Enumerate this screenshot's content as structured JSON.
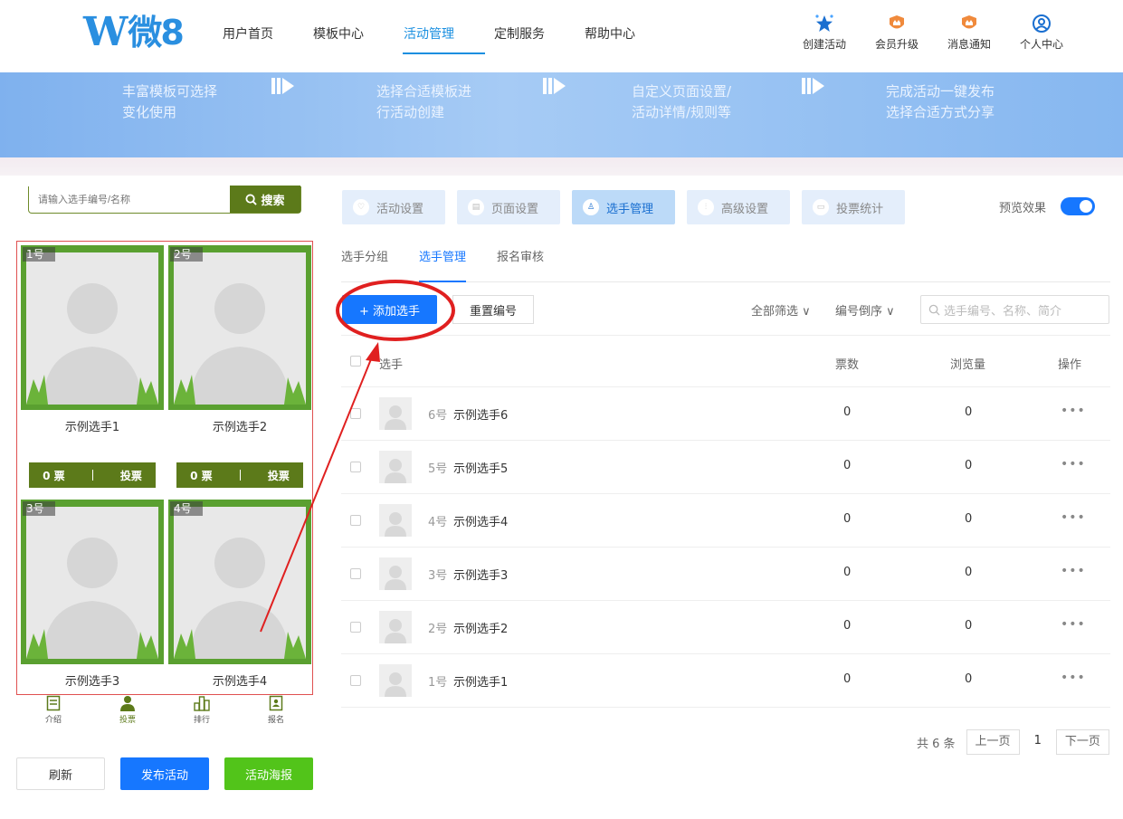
{
  "header": {
    "logo_text": "微8",
    "nav": [
      "用户首页",
      "模板中心",
      "活动管理",
      "定制服务",
      "帮助中心"
    ],
    "nav_active": "活动管理",
    "actions": [
      {
        "label": "创建活动",
        "icon": "star-icon"
      },
      {
        "label": "会员升级",
        "icon": "crown-badge-icon"
      },
      {
        "label": "消息通知",
        "icon": "crown-badge-icon"
      },
      {
        "label": "个人中心",
        "icon": "user-circle-icon"
      }
    ]
  },
  "banner": {
    "steps": [
      {
        "line1": "丰富模板可选择",
        "line2": "变化使用"
      },
      {
        "line1": "选择合适模板进",
        "line2": "行活动创建"
      },
      {
        "line1": "自定义页面设置/",
        "line2": "活动详情/规则等"
      },
      {
        "line1": "完成活动一键发布",
        "line2": "选择合适方式分享"
      }
    ]
  },
  "preview": {
    "search_placeholder": "请输入选手编号/名称",
    "search_button": "搜索",
    "cards": [
      {
        "badge": "1号",
        "name": "示例选手1",
        "votes": "0 票",
        "vote_button": "投票"
      },
      {
        "badge": "2号",
        "name": "示例选手2",
        "votes": "0 票",
        "vote_button": "投票"
      },
      {
        "badge": "3号",
        "name": "示例选手3"
      },
      {
        "badge": "4号",
        "name": "示例选手4"
      }
    ],
    "tabbar": [
      {
        "label": "介绍",
        "icon": "doc-icon"
      },
      {
        "label": "投票",
        "icon": "person-icon"
      },
      {
        "label": "排行",
        "icon": "rank-icon"
      },
      {
        "label": "报名",
        "icon": "signup-icon"
      }
    ],
    "buttons": {
      "refresh": "刷新",
      "publish": "发布活动",
      "poster": "活动海报"
    }
  },
  "settings_tabs": [
    "活动设置",
    "页面设置",
    "选手管理",
    "高级设置",
    "投票统计"
  ],
  "settings_tab_active": "选手管理",
  "preview_toggle": {
    "label": "预览效果",
    "on": true
  },
  "sub_tabs": [
    "选手分组",
    "选手管理",
    "报名审核"
  ],
  "sub_tab_active": "选手管理",
  "toolbar": {
    "add_button": "+ 添加选手",
    "reset_button": "重置编号",
    "filter_all": "全部筛选 ∨",
    "sort": "编号倒序 ∨",
    "search_placeholder": "选手编号、名称、简介"
  },
  "table": {
    "headers": {
      "player": "选手",
      "votes": "票数",
      "views": "浏览量",
      "actions": "操作"
    },
    "rows": [
      {
        "num": "6号",
        "name": "示例选手6",
        "votes": "0",
        "views": "0"
      },
      {
        "num": "5号",
        "name": "示例选手5",
        "votes": "0",
        "views": "0"
      },
      {
        "num": "4号",
        "name": "示例选手4",
        "votes": "0",
        "views": "0"
      },
      {
        "num": "3号",
        "name": "示例选手3",
        "votes": "0",
        "views": "0"
      },
      {
        "num": "2号",
        "name": "示例选手2",
        "votes": "0",
        "views": "0"
      },
      {
        "num": "1号",
        "name": "示例选手1",
        "votes": "0",
        "views": "0"
      }
    ],
    "more_label": "•••"
  },
  "pagination": {
    "total": "共 6 条",
    "prev": "上一页",
    "current": "1",
    "next": "下一页"
  },
  "colors": {
    "brand": "#1677ff",
    "preview_green": "#5c7a1a",
    "annotation_red": "#e02020"
  }
}
